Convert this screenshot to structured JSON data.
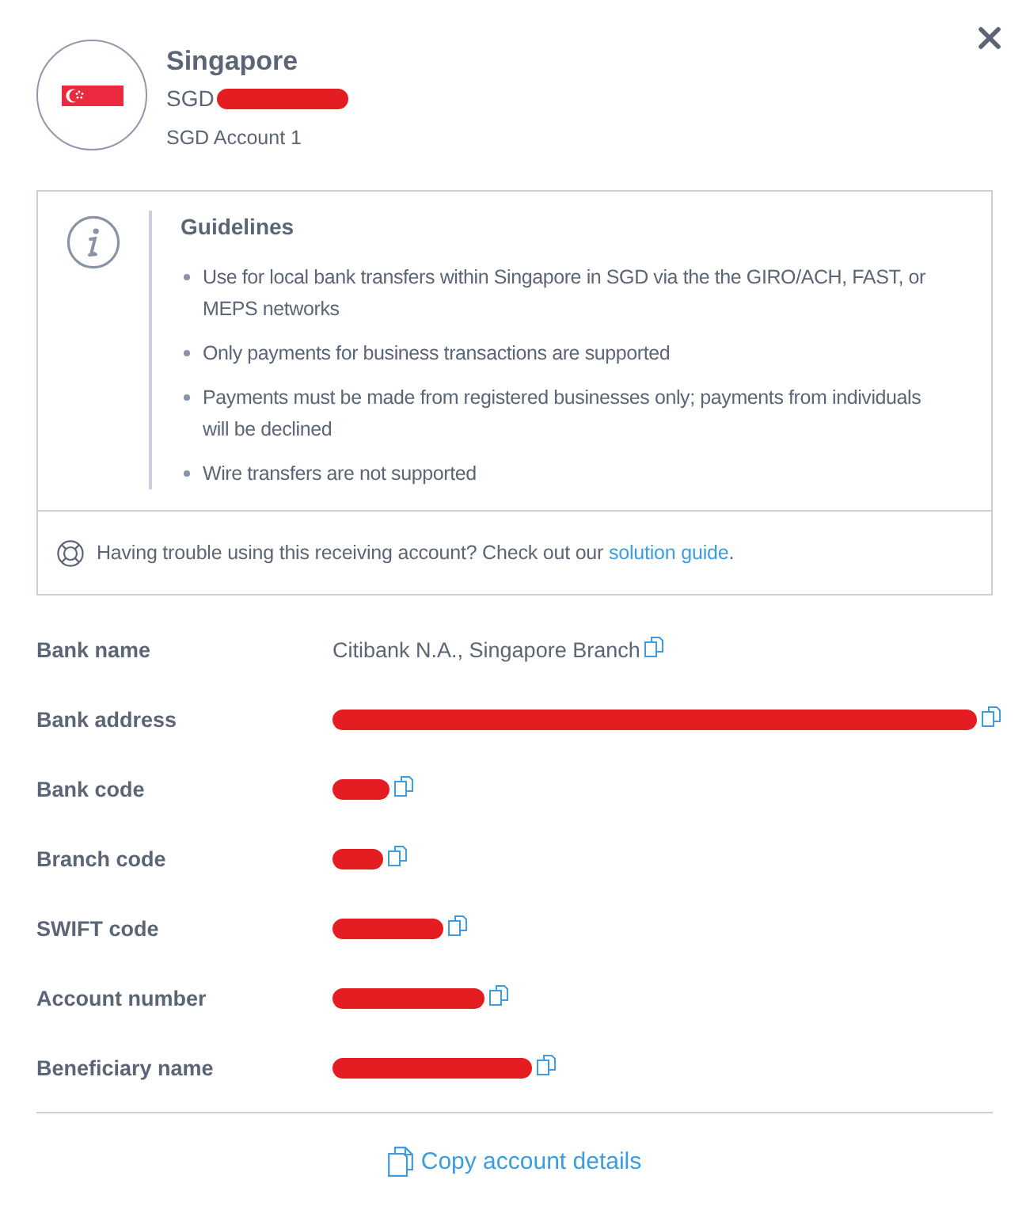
{
  "header": {
    "title": "Singapore",
    "currency": "SGD",
    "currency_redacted": true,
    "account_name": "SGD Account 1"
  },
  "guidelines": {
    "title": "Guidelines",
    "items": [
      "Use for local bank transfers within Singapore in SGD via the the GIRO/ACH, FAST, or MEPS networks",
      "Only payments for business transactions are supported",
      "Payments must be made from registered businesses only; payments from individuals will be declined",
      "Wire transfers are not supported"
    ],
    "help": {
      "prefix": "Having trouble using this receiving account? Check out our ",
      "link": "solution guide",
      "suffix": "."
    }
  },
  "details": [
    {
      "label": "Bank name",
      "value": "Citibank N.A., Singapore Branch",
      "redacted": false
    },
    {
      "label": "Bank address",
      "redacted": true
    },
    {
      "label": "Bank code",
      "redacted": true
    },
    {
      "label": "Branch code",
      "redacted": true
    },
    {
      "label": "SWIFT code",
      "redacted": true
    },
    {
      "label": "Account number",
      "redacted": true
    },
    {
      "label": "Beneficiary name",
      "redacted": true
    }
  ],
  "copy_button": {
    "label": "Copy account details"
  }
}
